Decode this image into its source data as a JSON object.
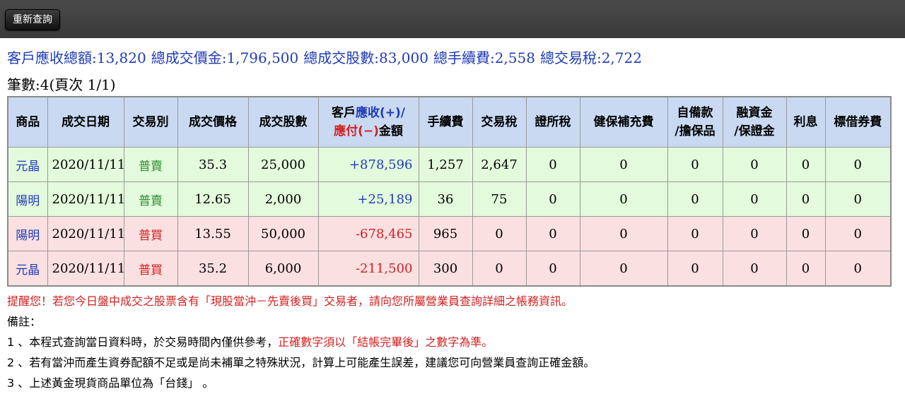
{
  "toolbar": {
    "requery_label": "重新查詢"
  },
  "summary": {
    "receivable": "客戶應收總額:13,820",
    "total_price": "總成交價金:1,796,500",
    "total_shares": "總成交股數:83,000",
    "total_fee": "總手續費:2,558",
    "total_tax": "總交易稅:2,722"
  },
  "count_text": "筆數:4(頁次 1/1)",
  "table": {
    "headers": {
      "stock": "商品",
      "date": "成交日期",
      "type": "交易別",
      "price": "成交價格",
      "shares": "成交股數",
      "amount_1": "客戶",
      "amount_2": "應收(+)/",
      "amount_3": "應付(−)",
      "amount_4": "金額",
      "fee": "手續費",
      "tax": "交易稅",
      "exchange_tax": "證所稅",
      "nhi": "健保補充費",
      "self_funds_1": "自備款",
      "self_funds_2": "/擔保品",
      "margin_1": "融資金",
      "margin_2": "/保證金",
      "interest": "利息",
      "lending_fee": "標借券費"
    },
    "rows": [
      {
        "stock": "元晶",
        "date": "2020/11/11",
        "type": "普賣",
        "price": "35.3",
        "shares": "25,000",
        "amount": "+878,596",
        "fee": "1,257",
        "tax": "2,647",
        "exchange_tax": "0",
        "nhi": "0",
        "self_funds": "0",
        "margin": "0",
        "interest": "0",
        "lending_fee": "0"
      },
      {
        "stock": "陽明",
        "date": "2020/11/11",
        "type": "普賣",
        "price": "12.65",
        "shares": "2,000",
        "amount": "+25,189",
        "fee": "36",
        "tax": "75",
        "exchange_tax": "0",
        "nhi": "0",
        "self_funds": "0",
        "margin": "0",
        "interest": "0",
        "lending_fee": "0"
      },
      {
        "stock": "陽明",
        "date": "2020/11/11",
        "type": "普買",
        "price": "13.55",
        "shares": "50,000",
        "amount": "-678,465",
        "fee": "965",
        "tax": "0",
        "exchange_tax": "0",
        "nhi": "0",
        "self_funds": "0",
        "margin": "0",
        "interest": "0",
        "lending_fee": "0"
      },
      {
        "stock": "元晶",
        "date": "2020/11/11",
        "type": "普買",
        "price": "35.2",
        "shares": "6,000",
        "amount": "-211,500",
        "fee": "300",
        "tax": "0",
        "exchange_tax": "0",
        "nhi": "0",
        "self_funds": "0",
        "margin": "0",
        "interest": "0",
        "lending_fee": "0"
      }
    ]
  },
  "notes": {
    "warning": "提醒您！若您今日盤中成交之股票含有「現股當沖－先賣後買」交易者，請向您所屬營業員查詢詳細之帳務資訊。",
    "title": "備註：",
    "item1_prefix": "1 、本程式查詢當日資料時，於交易時間內僅供參考，",
    "item1_red": "正確數字須以「結帳完畢後」之數字為準。",
    "item2": "2 、若有當沖而產生資券配額不足或是尚未補單之特殊狀況，計算上可能產生誤差，建議您可向營業員查詢正確金額。",
    "item3": "3 、上述黃金現貨商品單位為「台錢」 。"
  },
  "colors": {
    "header_bg": "#c9d9f2",
    "sell_row_bg": "#e3fbdc",
    "buy_row_bg": "#fbe0e1",
    "blue_text": "#1f3bb8",
    "red_text": "#d42020",
    "green_text": "#2e8f2e"
  }
}
